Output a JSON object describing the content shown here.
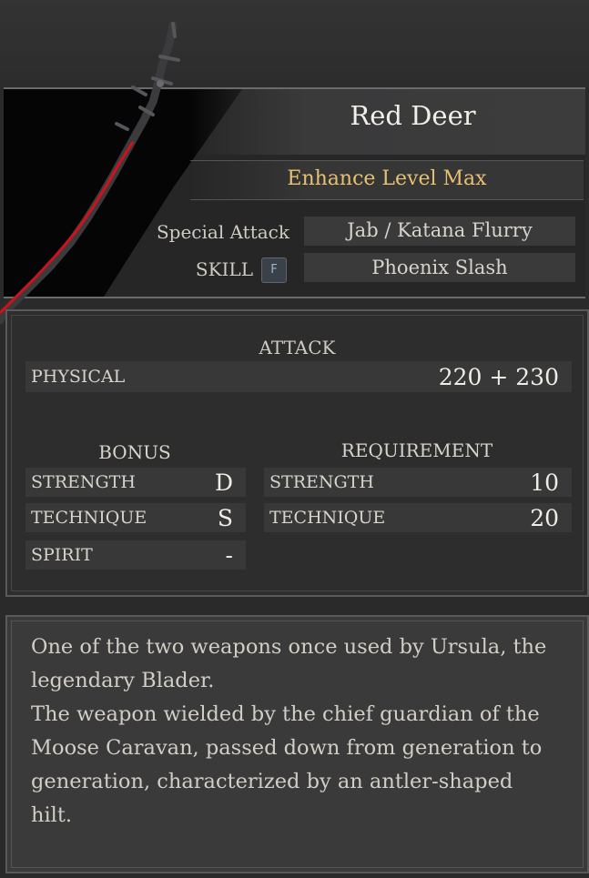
{
  "item": {
    "name": "Red Deer",
    "enhance": "Enhance Level Max",
    "special_attack_label": "Special Attack",
    "special_attack_value": "Jab / Katana Flurry",
    "skill_label": "SKILL",
    "skill_key": "F",
    "skill_value": "Phoenix Slash"
  },
  "attack": {
    "header": "ATTACK",
    "physical_label": "PHYSICAL",
    "physical_value": "220 + 230"
  },
  "bonus": {
    "header": "BONUS",
    "rows": [
      {
        "label": "STRENGTH",
        "value": "D"
      },
      {
        "label": "TECHNIQUE",
        "value": "S"
      },
      {
        "label": "SPIRIT",
        "value": "-"
      }
    ]
  },
  "requirement": {
    "header": "REQUIREMENT",
    "rows": [
      {
        "label": "STRENGTH",
        "value": "10"
      },
      {
        "label": "TECHNIQUE",
        "value": "20"
      }
    ]
  },
  "description": {
    "lines": [
      "One of the two weapons once used by Ursula, the",
      "legendary Blader.",
      "The weapon wielded by the chief guardian of the",
      "Moose Caravan, passed down from generation to",
      "generation, characterized by an antler-shaped",
      "hilt."
    ]
  },
  "colors": {
    "accent_gold": "#e7c170",
    "blade_red": "#d0101a",
    "panel_bg": "#2d2d2e"
  },
  "icons": {
    "weapon": "katana-icon",
    "key_badge": "keyboard-f-icon"
  }
}
